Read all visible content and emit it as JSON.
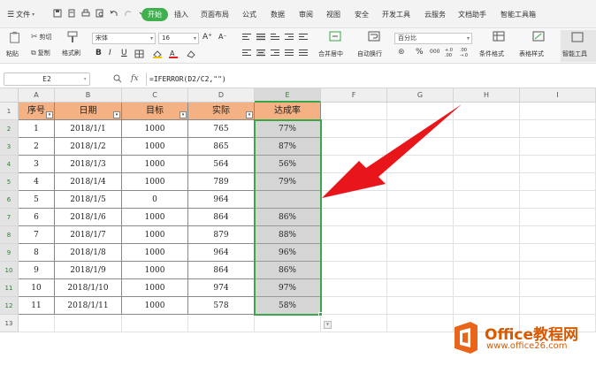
{
  "menubar": {
    "file_label": "文件",
    "tabs": [
      "开始",
      "插入",
      "页面布局",
      "公式",
      "数据",
      "审阅",
      "视图",
      "安全",
      "开发工具",
      "云服务",
      "文档助手",
      "智能工具箱"
    ]
  },
  "ribbon": {
    "paste_label": "粘贴",
    "cut_label": "剪切",
    "copy_label": "复制",
    "format_painter_label": "格式刷",
    "font_name": "宋体",
    "font_size": "16",
    "grow_font": "A⁺",
    "shrink_font": "A⁻",
    "bold": "B",
    "italic": "I",
    "underline": "U",
    "merge_label": "合并居中",
    "wrap_label": "自动换行",
    "number_format": "百分比",
    "percent_symbol": "%",
    "thousands_symbol": "000",
    "inc_decimal": "+.0 .00",
    "dec_decimal": ".00 →.0",
    "cond_format_label": "条件格式",
    "table_style_label": "表格样式",
    "smart_tool_label": "智能工具"
  },
  "formula_bar": {
    "name_box": "E2",
    "fx_label": "fx",
    "formula": "=IFERROR(D2/C2,\"\")"
  },
  "sheet": {
    "columns": [
      "A",
      "B",
      "C",
      "D",
      "E",
      "F",
      "G",
      "H",
      "I"
    ],
    "rows": [
      "1",
      "2",
      "3",
      "4",
      "5",
      "6",
      "7",
      "8",
      "9",
      "10",
      "11",
      "12",
      "13"
    ],
    "selected_column": "E",
    "selected_cell": "E2",
    "headers": [
      "序号",
      "日期",
      "目标",
      "实际",
      "达成率"
    ],
    "data": [
      [
        "1",
        "2018/1/1",
        "1000",
        "765",
        "77%"
      ],
      [
        "2",
        "2018/1/2",
        "1000",
        "865",
        "87%"
      ],
      [
        "3",
        "2018/1/3",
        "1000",
        "564",
        "56%"
      ],
      [
        "4",
        "2018/1/4",
        "1000",
        "789",
        "79%"
      ],
      [
        "5",
        "2018/1/5",
        "0",
        "964",
        ""
      ],
      [
        "6",
        "2018/1/6",
        "1000",
        "864",
        "86%"
      ],
      [
        "7",
        "2018/1/7",
        "1000",
        "879",
        "88%"
      ],
      [
        "8",
        "2018/1/8",
        "1000",
        "964",
        "96%"
      ],
      [
        "9",
        "2018/1/9",
        "1000",
        "864",
        "86%"
      ],
      [
        "10",
        "2018/1/10",
        "1000",
        "974",
        "97%"
      ],
      [
        "11",
        "2018/1/11",
        "1000",
        "578",
        "58%"
      ]
    ]
  },
  "annotation": {
    "arrow_color": "#e8161b",
    "points_to": "E6"
  },
  "logo": {
    "title": "Office教程网",
    "url": "www.office26.com",
    "color": "#d75a00"
  },
  "colors": {
    "accent": "#3aa54a",
    "header_fill": "#f4b183",
    "percent_fill": "#d5d5d5",
    "active_tab": "#3fb04d"
  }
}
